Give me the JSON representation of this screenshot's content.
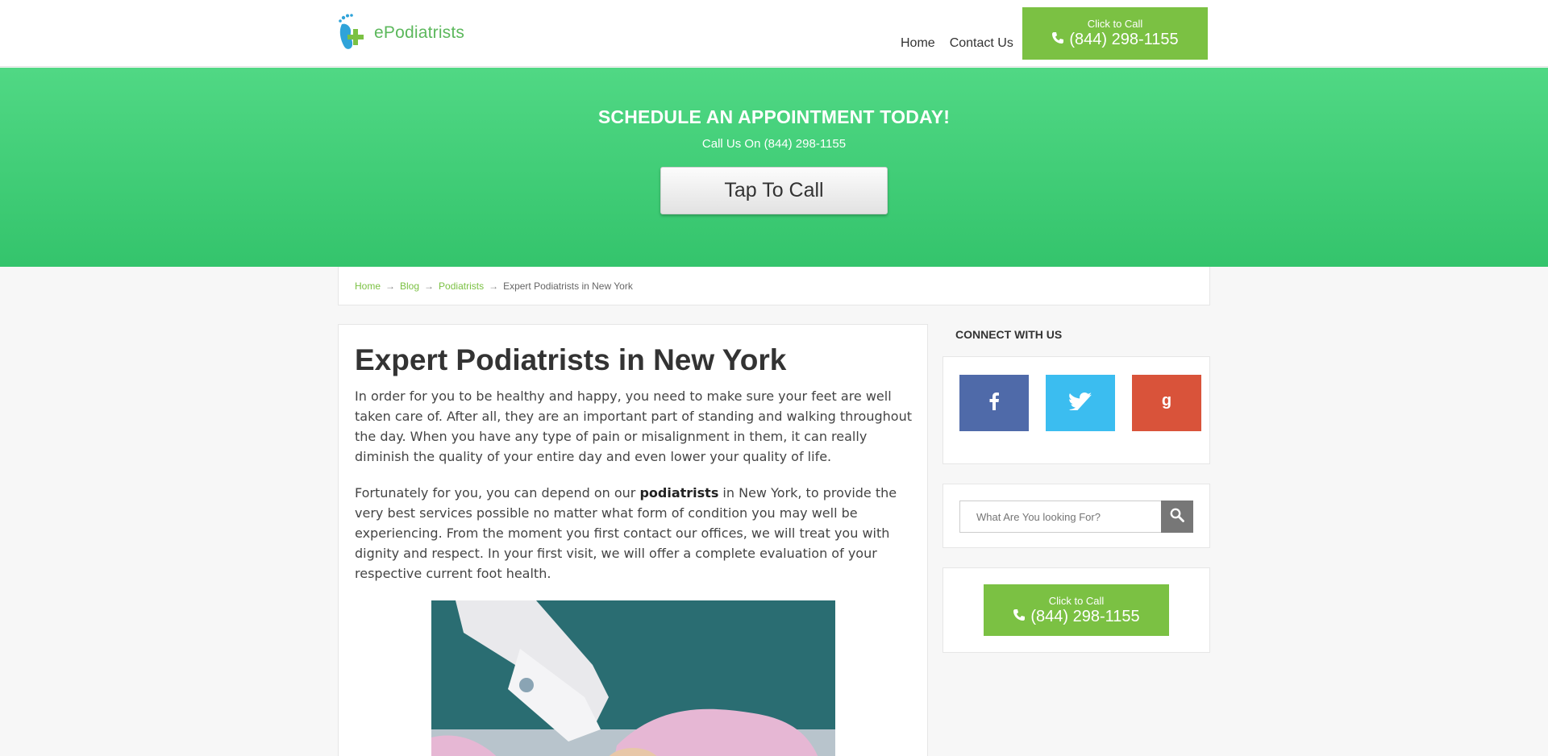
{
  "header": {
    "logo_text": "ePodiatrists",
    "nav": [
      "Home",
      "Contact Us"
    ],
    "call_small": "Click to Call",
    "call_number": "(844) 298-1155"
  },
  "hero": {
    "title": "SCHEDULE AN APPOINTMENT TODAY!",
    "subtitle": "Call Us On (844) 298-1155",
    "button": "Tap To Call"
  },
  "breadcrumb": {
    "items": [
      "Home",
      "Blog",
      "Podiatrists"
    ],
    "current": "Expert Podiatrists in New York",
    "separator": "→"
  },
  "article": {
    "title": "Expert Podiatrists in New York",
    "para1": "In order for you to be healthy and happy, you need to make sure your feet are well taken care of. After all, they are an important part of standing and walking throughout the day. When you have any type of pain or misalignment in them, it can really diminish the quality of your entire day and even lower your quality of life.",
    "para2_before": "Fortunately for you, you can depend on our ",
    "para2_bold": "podiatrists",
    "para2_after": " in New York, to provide the very best services possible no matter what form of condition you may well be experiencing. From the moment you first contact our offices, we will treat you with dignity and respect. In your first visit, we will offer a complete evaluation of your respective current foot health."
  },
  "sidebar": {
    "connect_title": "CONNECT WITH US",
    "social_icons": [
      "facebook-icon",
      "twitter-icon",
      "google-plus-icon"
    ],
    "search_placeholder": "What Are You looking For?",
    "call_small": "Click to Call",
    "call_number": "(844) 298-1155"
  },
  "colors": {
    "brand_green": "#7bc143",
    "hero_green": "#3dcc74",
    "facebook": "#4f6aa9",
    "twitter": "#3bbdf0",
    "google": "#d9533a"
  }
}
